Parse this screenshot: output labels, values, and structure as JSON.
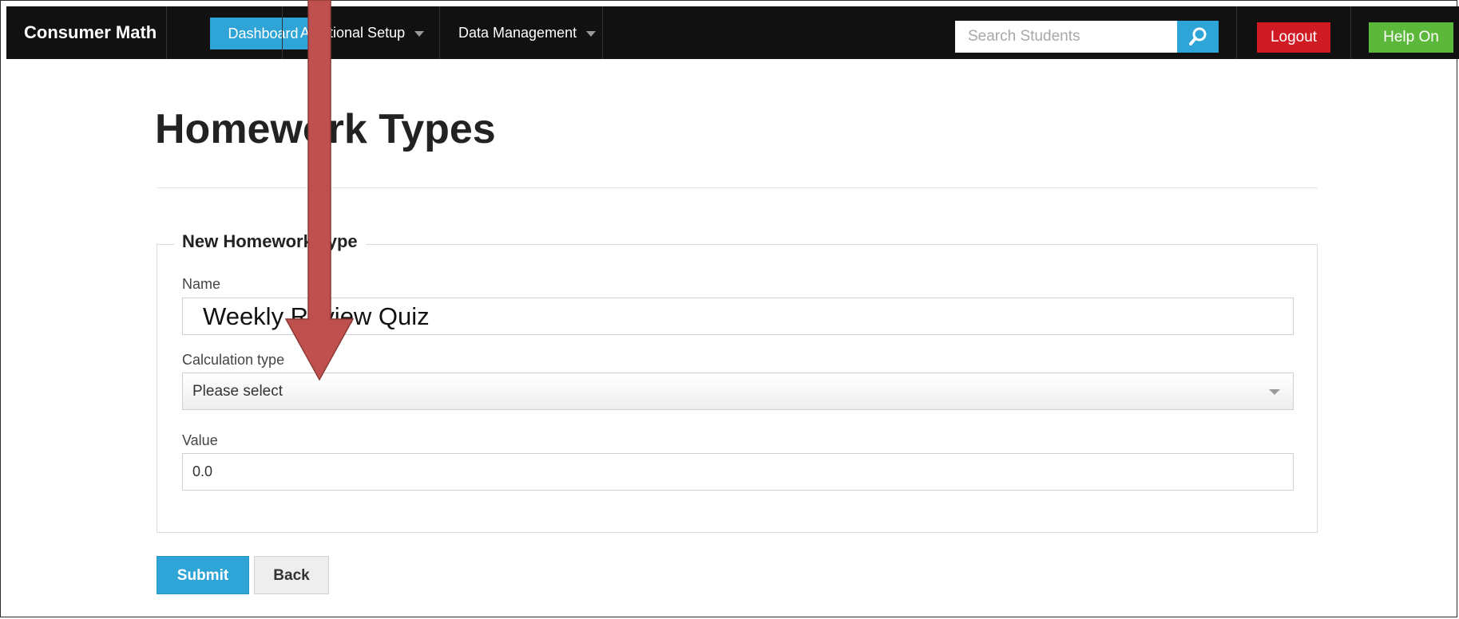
{
  "navbar": {
    "brand": "Consumer Math",
    "dashboard_label": "Dashboard",
    "additional_setup_label": "Additional Setup",
    "data_management_label": "Data Management",
    "search_placeholder": "Search Students",
    "logout_label": "Logout",
    "help_label": "Help On"
  },
  "page": {
    "title": "Homework Types"
  },
  "form": {
    "legend": "New Homework Type",
    "name_label": "Name",
    "name_value": "Weekly Review Quiz",
    "calc_type_label": "Calculation type",
    "calc_type_value": "Please select",
    "value_label": "Value",
    "value_value": "0.0",
    "submit_label": "Submit",
    "back_label": "Back"
  },
  "colors": {
    "navbar_bg": "#111111",
    "accent_blue": "#2fa4d7",
    "logout_red": "#d11b24",
    "help_green": "#5cb83a",
    "annotation_arrow": "#c0504d"
  },
  "icons": {
    "search": "search-icon",
    "dropdown": "chevron-down-icon",
    "annotation": "arrow-down-icon"
  }
}
